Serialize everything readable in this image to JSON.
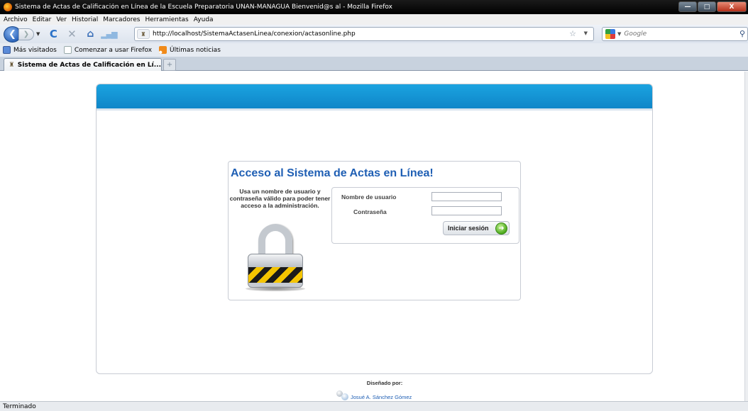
{
  "window": {
    "title": "Sistema de Actas de Calificación en Línea de la Escuela Preparatoria UNAN-MANAGUA Bienvenid@s al - Mozilla Firefox",
    "minimize": "—",
    "maximize": "□",
    "close": "X"
  },
  "menu": {
    "items": [
      "Archivo",
      "Editar",
      "Ver",
      "Historial",
      "Marcadores",
      "Herramientas",
      "Ayuda"
    ]
  },
  "toolbar": {
    "url": "http://localhost/SistemaActasenLinea/conexion/actasonline.php",
    "search_placeholder": "Google"
  },
  "bookmarks": {
    "items": [
      "Más visitados",
      "Comenzar a usar Firefox",
      "Últimas noticias"
    ]
  },
  "tabs": {
    "active": "Sistema de Actas de Calificación en Lí...",
    "new_tab": "+"
  },
  "login": {
    "title": "Acceso al Sistema de Actas en Línea!",
    "help_text": "Usa un nombre de usuario y contraseña válido para poder tener acceso a la administración.",
    "username_label": "Nombre de usuario",
    "password_label": "Contraseña",
    "username_value": "",
    "password_value": "",
    "submit_label": "Iniciar sesión"
  },
  "footer": {
    "designed_by": "Diseñado por:",
    "author": "Josué A. Sánchez Gómez"
  },
  "status": {
    "text": "Terminado"
  }
}
